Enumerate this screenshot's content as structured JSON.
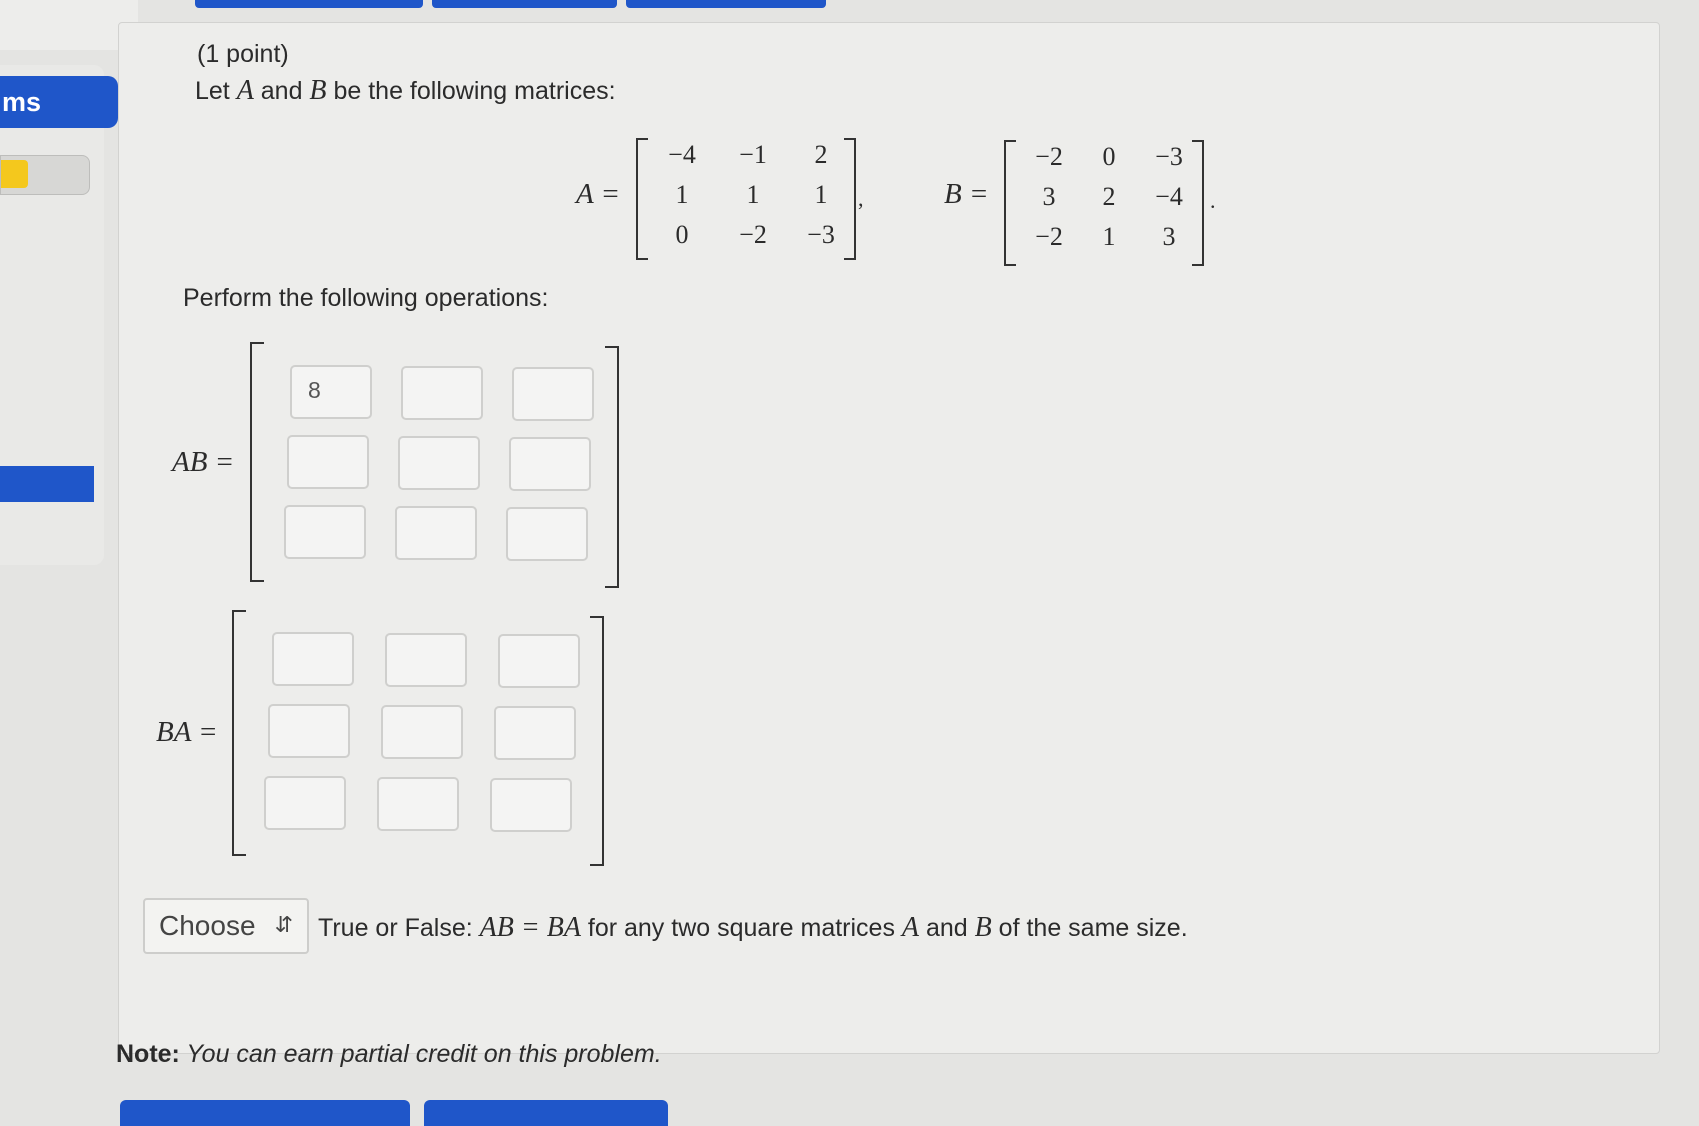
{
  "nav": {
    "tab_label": "ms"
  },
  "problem": {
    "points": "(1 point)",
    "intro": {
      "pre": "Let ",
      "var_a": "A",
      "mid": " and ",
      "var_b": "B",
      "post": " be the following matrices:"
    },
    "matrix_a": {
      "label": "A =",
      "rows": [
        [
          "−4",
          "−1",
          "2"
        ],
        [
          "1",
          "1",
          "1"
        ],
        [
          "0",
          "−2",
          "−3"
        ]
      ],
      "trail": ","
    },
    "matrix_b": {
      "label": "B =",
      "rows": [
        [
          "−2",
          "0",
          "−3"
        ],
        [
          "3",
          "2",
          "−4"
        ],
        [
          "−2",
          "1",
          "3"
        ]
      ],
      "trail": "."
    },
    "operations_text": "Perform the following operations:",
    "ab": {
      "label": "AB =",
      "cells": [
        "8",
        "",
        "",
        "",
        "",
        "",
        "",
        "",
        ""
      ]
    },
    "ba": {
      "label": "BA =",
      "cells": [
        "",
        "",
        "",
        "",
        "",
        "",
        "",
        "",
        ""
      ]
    },
    "true_false": {
      "select_value": "Choose",
      "pre": "True or False: ",
      "equation": "AB = BA",
      "mid": " for any two square matrices ",
      "var_a": "A",
      "and": " and ",
      "var_b": "B",
      "post": " of the same size."
    },
    "note": {
      "label": "Note:",
      "text": " You can earn partial credit on this problem."
    }
  }
}
